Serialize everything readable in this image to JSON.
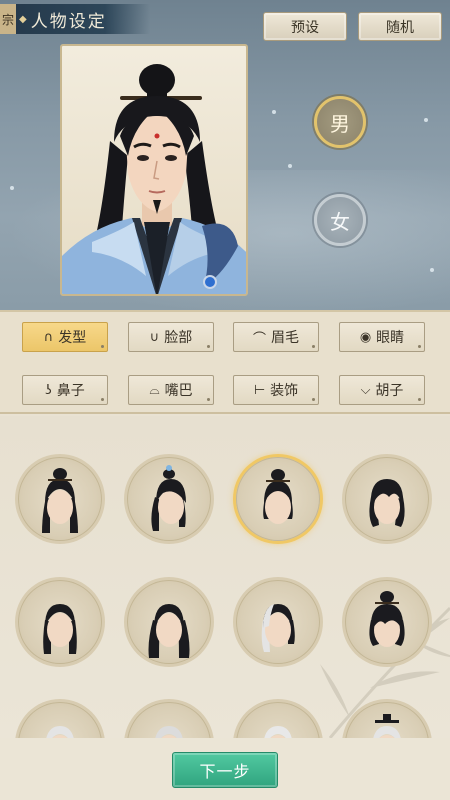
{
  "header": {
    "title": "人物设定",
    "emblem_glyph": "宗",
    "preset_label": "预设",
    "random_label": "随机"
  },
  "gender": {
    "male_label": "男",
    "female_label": "女",
    "selected": "male"
  },
  "categories": [
    {
      "label": "发型",
      "icon": "hair-icon",
      "glyph": "∩",
      "active": true
    },
    {
      "label": "脸部",
      "icon": "face-icon",
      "glyph": "∪",
      "active": false
    },
    {
      "label": "眉毛",
      "icon": "eyebrow-icon",
      "glyph": "⌒",
      "active": false
    },
    {
      "label": "眼睛",
      "icon": "eye-icon",
      "glyph": "◉",
      "active": false
    },
    {
      "label": "鼻子",
      "icon": "nose-icon",
      "glyph": "ʖ",
      "active": false
    },
    {
      "label": "嘴巴",
      "icon": "mouth-icon",
      "glyph": "⌓",
      "active": false
    },
    {
      "label": "装饰",
      "icon": "ornament-icon",
      "glyph": "⊢",
      "active": false
    },
    {
      "label": "胡子",
      "icon": "beard-icon",
      "glyph": "⌵",
      "active": false
    }
  ],
  "hairstyles": {
    "selected_index": 2,
    "items": [
      "hairstyle-1",
      "hairstyle-2",
      "hairstyle-3",
      "hairstyle-4",
      "hairstyle-5",
      "hairstyle-6",
      "hairstyle-7",
      "hairstyle-8",
      "hairstyle-9",
      "hairstyle-10",
      "hairstyle-11",
      "hairstyle-12"
    ]
  },
  "footer": {
    "next_label": "下一步"
  },
  "colors": {
    "accent_gold": "#ecc669",
    "next_button_green": "#3ab38b",
    "hair_black": "#1b1b1f",
    "hair_white": "#e4e4e4"
  }
}
